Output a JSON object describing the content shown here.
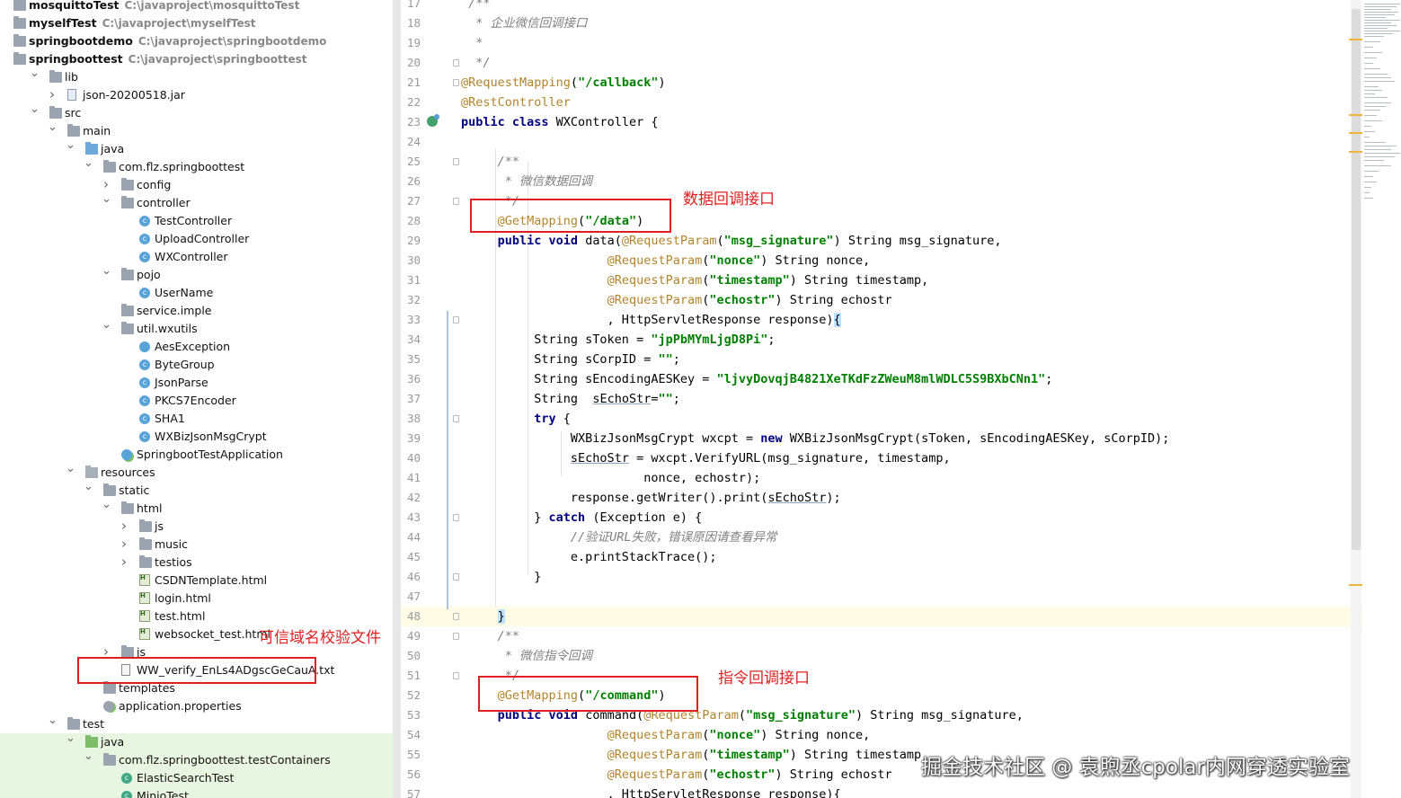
{
  "tree": [
    {
      "d": 0,
      "i": "folder",
      "n": "mosquittoTest",
      "b": true,
      "p": "C:\\javaproject\\mosquittoTest",
      "a": ""
    },
    {
      "d": 0,
      "i": "folder",
      "n": "myselfTest",
      "b": true,
      "p": "C:\\javaproject\\myselfTest",
      "a": ""
    },
    {
      "d": 0,
      "i": "folder",
      "n": "springbootdemo",
      "b": true,
      "p": "C:\\javaproject\\springbootdemo",
      "a": ""
    },
    {
      "d": 0,
      "i": "folder",
      "n": "springboottest",
      "b": true,
      "p": "C:\\javaproject\\springboottest",
      "a": "v"
    },
    {
      "d": 1,
      "i": "folder",
      "n": "lib",
      "a": "v"
    },
    {
      "d": 2,
      "i": "jar",
      "n": "json-20200518.jar",
      "a": ">"
    },
    {
      "d": 1,
      "i": "folder",
      "n": "src",
      "a": "v"
    },
    {
      "d": 2,
      "i": "folder",
      "n": "main",
      "a": "v"
    },
    {
      "d": 3,
      "i": "src",
      "n": "java",
      "a": "v"
    },
    {
      "d": 4,
      "i": "folder",
      "n": "com.flz.springboottest",
      "a": "v"
    },
    {
      "d": 5,
      "i": "folder",
      "n": "config",
      "a": ">"
    },
    {
      "d": 5,
      "i": "folder",
      "n": "controller",
      "a": "v"
    },
    {
      "d": 6,
      "i": "class",
      "n": "TestController",
      "a": ""
    },
    {
      "d": 6,
      "i": "class",
      "n": "UploadController",
      "a": ""
    },
    {
      "d": 6,
      "i": "class",
      "n": "WXController",
      "a": ""
    },
    {
      "d": 5,
      "i": "folder",
      "n": "pojo",
      "a": "v"
    },
    {
      "d": 6,
      "i": "class",
      "n": "UserName",
      "a": ""
    },
    {
      "d": 5,
      "i": "folder",
      "n": "service.imple",
      "a": ""
    },
    {
      "d": 5,
      "i": "folder",
      "n": "util.wxutils",
      "a": "v"
    },
    {
      "d": 6,
      "i": "exc",
      "n": "AesException",
      "a": ""
    },
    {
      "d": 6,
      "i": "class",
      "n": "ByteGroup",
      "a": ""
    },
    {
      "d": 6,
      "i": "class",
      "n": "JsonParse",
      "a": ""
    },
    {
      "d": 6,
      "i": "class",
      "n": "PKCS7Encoder",
      "a": ""
    },
    {
      "d": 6,
      "i": "class",
      "n": "SHA1",
      "a": ""
    },
    {
      "d": 6,
      "i": "class",
      "n": "WXBizJsonMsgCrypt",
      "a": ""
    },
    {
      "d": 5,
      "i": "app",
      "n": "SpringbootTestApplication",
      "a": ""
    },
    {
      "d": 3,
      "i": "res",
      "n": "resources",
      "a": "v"
    },
    {
      "d": 4,
      "i": "folder",
      "n": "static",
      "a": "v"
    },
    {
      "d": 5,
      "i": "folder",
      "n": "html",
      "a": "v"
    },
    {
      "d": 6,
      "i": "folder",
      "n": "js",
      "a": ">"
    },
    {
      "d": 6,
      "i": "folder",
      "n": "music",
      "a": ">"
    },
    {
      "d": 6,
      "i": "folder",
      "n": "testios",
      "a": ">"
    },
    {
      "d": 6,
      "i": "html",
      "n": "CSDNTemplate.html",
      "a": ""
    },
    {
      "d": 6,
      "i": "html",
      "n": "login.html",
      "a": ""
    },
    {
      "d": 6,
      "i": "html",
      "n": "test.html",
      "a": ""
    },
    {
      "d": 6,
      "i": "html",
      "n": "websocket_test.html",
      "a": ""
    },
    {
      "d": 5,
      "i": "folder",
      "n": "js",
      "a": ">"
    },
    {
      "d": 5,
      "i": "txt",
      "n": "WW_verify_EnLs4ADgscGeCauA.txt",
      "a": ""
    },
    {
      "d": 4,
      "i": "folder",
      "n": "templates",
      "a": ""
    },
    {
      "d": 4,
      "i": "prop",
      "n": "application.properties",
      "a": ""
    },
    {
      "d": 2,
      "i": "folder",
      "n": "test",
      "a": "v"
    },
    {
      "d": 3,
      "i": "test",
      "n": "java",
      "a": "v",
      "h": true
    },
    {
      "d": 4,
      "i": "folder",
      "n": "com.flz.springboottest.testContainers",
      "a": "v",
      "h": true
    },
    {
      "d": 5,
      "i": "testclass",
      "n": "ElasticSearchTest",
      "a": "",
      "h": true
    },
    {
      "d": 5,
      "i": "testclass",
      "n": "MinioTest",
      "a": "",
      "h": true
    }
  ],
  "code": [
    {
      "n": "17",
      "t": [
        [
          "cm",
          " /**"
        ]
      ]
    },
    {
      "n": "18",
      "t": [
        [
          "cm",
          "  * 企业微信回调接口"
        ]
      ]
    },
    {
      "n": "19",
      "t": [
        [
          "cm",
          "  *"
        ]
      ]
    },
    {
      "n": "20",
      "t": [
        [
          "cm",
          "  */"
        ]
      ],
      "f": true
    },
    {
      "n": "21",
      "t": [
        [
          "an",
          "@RequestMapping"
        ],
        [
          "",
          "("
        ],
        [
          "st",
          "\"/callback\""
        ],
        [
          "",
          ")"
        ]
      ],
      "f": true
    },
    {
      "n": "22",
      "t": [
        [
          "an",
          "@RestController"
        ]
      ]
    },
    {
      "n": "23",
      "t": [
        [
          "kw",
          "public class "
        ],
        [
          "",
          "WXController {"
        ]
      ],
      "g": true
    },
    {
      "n": "24",
      "t": []
    },
    {
      "n": "25",
      "t": [
        [
          "cm",
          "     /**"
        ]
      ],
      "f": true
    },
    {
      "n": "26",
      "t": [
        [
          "cm",
          "      * 微信数据回调"
        ]
      ]
    },
    {
      "n": "27",
      "t": [
        [
          "cm",
          "      */"
        ]
      ],
      "f": true
    },
    {
      "n": "28",
      "t": [
        [
          "",
          "     "
        ],
        [
          "an",
          "@GetMapping"
        ],
        [
          "",
          "("
        ],
        [
          "st",
          "\"/data\""
        ],
        [
          "",
          ")"
        ]
      ]
    },
    {
      "n": "29",
      "t": [
        [
          "",
          "     "
        ],
        [
          "kw",
          "public void "
        ],
        [
          "",
          "data("
        ],
        [
          "an",
          "@RequestParam"
        ],
        [
          "",
          "("
        ],
        [
          "st",
          "\"msg_signature\""
        ],
        [
          "",
          ") String msg_signature,"
        ]
      ]
    },
    {
      "n": "30",
      "t": [
        [
          "",
          "                    "
        ],
        [
          "an",
          "@RequestParam"
        ],
        [
          "",
          "("
        ],
        [
          "st",
          "\"nonce\""
        ],
        [
          "",
          ") String nonce,"
        ]
      ]
    },
    {
      "n": "31",
      "t": [
        [
          "",
          "                    "
        ],
        [
          "an",
          "@RequestParam"
        ],
        [
          "",
          "("
        ],
        [
          "st",
          "\"timestamp\""
        ],
        [
          "",
          ") String timestamp,"
        ]
      ]
    },
    {
      "n": "32",
      "t": [
        [
          "",
          "                    "
        ],
        [
          "an",
          "@RequestParam"
        ],
        [
          "",
          "("
        ],
        [
          "st",
          "\"echostr\""
        ],
        [
          "",
          ") String echostr"
        ]
      ]
    },
    {
      "n": "33",
      "t": [
        [
          "",
          "                    , HttpServletResponse response)"
        ],
        [
          "bh",
          "{"
        ]
      ],
      "f": true
    },
    {
      "n": "34",
      "t": [
        [
          "",
          "          String sToken = "
        ],
        [
          "st",
          "\"jpPbMYmLjgD8Pi\""
        ],
        [
          "",
          ";"
        ]
      ]
    },
    {
      "n": "35",
      "t": [
        [
          "",
          "          String sCorpID = "
        ],
        [
          "st",
          "\"\""
        ],
        [
          "",
          ";"
        ]
      ]
    },
    {
      "n": "36",
      "t": [
        [
          "",
          "          String sEncodingAESKey = "
        ],
        [
          "st",
          "\"ljvyDovqjB4821XeTKdFzZWeuM8mlWDLC5S9BXbCNn1\""
        ],
        [
          "",
          ";"
        ]
      ]
    },
    {
      "n": "37",
      "t": [
        [
          "",
          "          String  "
        ],
        [
          "ul",
          "sEchoStr"
        ],
        [
          "",
          "="
        ],
        [
          "st",
          "\"\""
        ],
        [
          "",
          ";"
        ]
      ]
    },
    {
      "n": "38",
      "t": [
        [
          "",
          "          "
        ],
        [
          "kw",
          "try"
        ],
        [
          "",
          " {"
        ]
      ],
      "f": true
    },
    {
      "n": "39",
      "t": [
        [
          "",
          "               WXBizJsonMsgCrypt wxcpt = "
        ],
        [
          "kw",
          "new"
        ],
        [
          "",
          " WXBizJsonMsgCrypt(sToken, sEncodingAESKey, sCorpID);"
        ]
      ]
    },
    {
      "n": "40",
      "t": [
        [
          "",
          "               "
        ],
        [
          "ul",
          "sEchoStr"
        ],
        [
          "",
          " = wxcpt.VerifyURL(msg_signature, timestamp,"
        ]
      ]
    },
    {
      "n": "41",
      "t": [
        [
          "",
          "                         nonce, echostr);"
        ]
      ]
    },
    {
      "n": "42",
      "t": [
        [
          "",
          "               response.getWriter().print("
        ],
        [
          "ul",
          "sEchoStr"
        ],
        [
          "",
          ");"
        ]
      ]
    },
    {
      "n": "43",
      "t": [
        [
          "",
          "          } "
        ],
        [
          "kw",
          "catch"
        ],
        [
          "",
          " (Exception e) {"
        ]
      ],
      "f": true
    },
    {
      "n": "44",
      "t": [
        [
          "",
          "               "
        ],
        [
          "cm",
          "//验证URL失败，错误原因请查看异常"
        ]
      ]
    },
    {
      "n": "45",
      "t": [
        [
          "",
          "               e.printStackTrace();"
        ]
      ]
    },
    {
      "n": "46",
      "t": [
        [
          "",
          "          }"
        ]
      ],
      "f": true
    },
    {
      "n": "47",
      "t": []
    },
    {
      "n": "48",
      "t": [
        [
          "",
          "     "
        ],
        [
          "bh",
          "}"
        ]
      ],
      "cur": true,
      "f": true
    },
    {
      "n": "49",
      "t": [
        [
          "cm",
          "     /**"
        ]
      ],
      "f": true
    },
    {
      "n": "50",
      "t": [
        [
          "cm",
          "      * 微信指令回调"
        ]
      ]
    },
    {
      "n": "51",
      "t": [
        [
          "cm",
          "      */"
        ]
      ],
      "f": true
    },
    {
      "n": "52",
      "t": [
        [
          "",
          "     "
        ],
        [
          "an",
          "@GetMapping"
        ],
        [
          "",
          "("
        ],
        [
          "st",
          "\"/command\""
        ],
        [
          "",
          ")"
        ]
      ]
    },
    {
      "n": "53",
      "t": [
        [
          "",
          "     "
        ],
        [
          "kw",
          "public void "
        ],
        [
          "",
          "command("
        ],
        [
          "an",
          "@RequestParam"
        ],
        [
          "",
          "("
        ],
        [
          "st",
          "\"msg_signature\""
        ],
        [
          "",
          ") String msg_signature,"
        ]
      ]
    },
    {
      "n": "54",
      "t": [
        [
          "",
          "                    "
        ],
        [
          "an",
          "@RequestParam"
        ],
        [
          "",
          "("
        ],
        [
          "st",
          "\"nonce\""
        ],
        [
          "",
          ") String nonce,"
        ]
      ]
    },
    {
      "n": "55",
      "t": [
        [
          "",
          "                    "
        ],
        [
          "an",
          "@RequestParam"
        ],
        [
          "",
          "("
        ],
        [
          "st",
          "\"timestamp\""
        ],
        [
          "",
          ") String timestamp,"
        ]
      ]
    },
    {
      "n": "56",
      "t": [
        [
          "",
          "                    "
        ],
        [
          "an",
          "@RequestParam"
        ],
        [
          "",
          "("
        ],
        [
          "st",
          "\"echostr\""
        ],
        [
          "",
          ") String echostr"
        ]
      ]
    },
    {
      "n": "57",
      "t": [
        [
          "",
          "                    , HttpServletResponse response){"
        ]
      ]
    }
  ],
  "annotations": {
    "data_callback": "数据回调接口",
    "verify_file": "可信域名校验文件",
    "command_callback": "指令回调接口"
  },
  "watermark": "掘金技术社区 @ 袁煦丞cpolar内网穿透实验室",
  "colors": {
    "annotation": "#e02020",
    "keyword": "#000080",
    "annotation_code": "#b2842c",
    "string": "#008000",
    "comment": "#808080"
  }
}
